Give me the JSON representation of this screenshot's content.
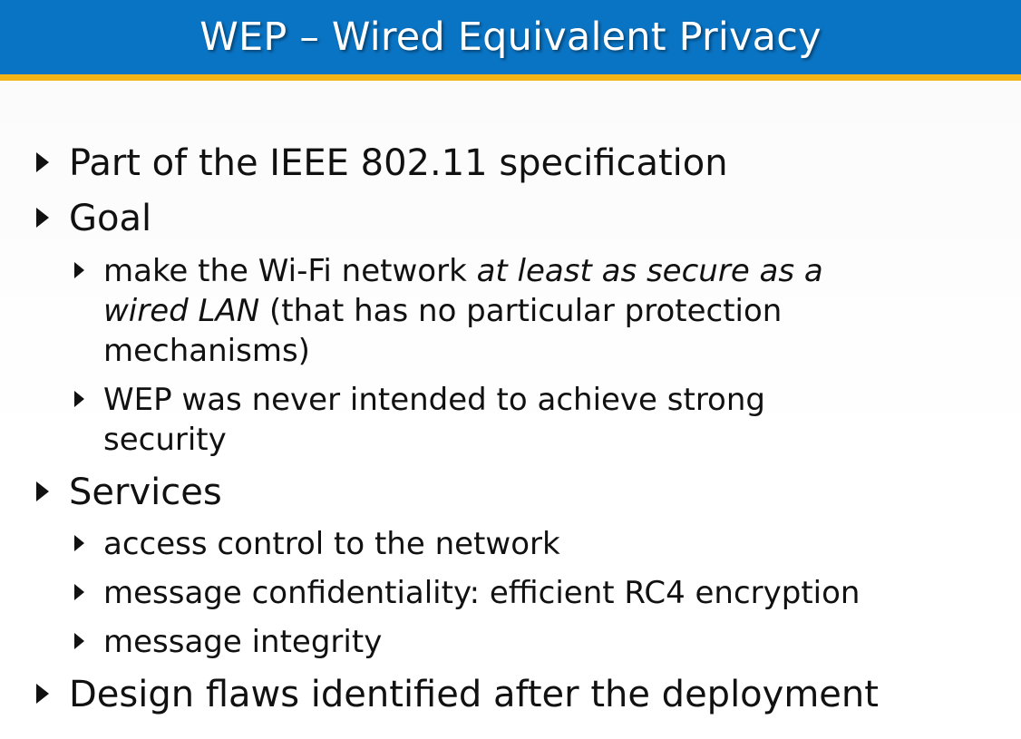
{
  "slide": {
    "title": "WEP – Wired Equivalent Privacy",
    "bullets": {
      "spec": "Part of the IEEE 802.11 specification",
      "goal": "Goal",
      "goal_item1": {
        "prefix": "make the Wi-Fi network ",
        "emphasis_a": "at least as secure as a",
        "emphasis_b": "wired LAN",
        "rest_a": " (that has no particular protection",
        "rest_b": "mechanisms)"
      },
      "goal_item2": {
        "line1": "WEP was never intended to achieve strong",
        "line2": "security"
      },
      "services": "Services",
      "services_items": [
        "access control to the network",
        "message confidentiality:  efficient RC4 encryption",
        "message integrity"
      ],
      "flaws": "Design flaws identified after the deployment"
    },
    "colors": {
      "title_bar": "#0a74c4",
      "accent_line": "#f3b417",
      "title_text": "#ffffff",
      "body_text": "#111111"
    }
  }
}
